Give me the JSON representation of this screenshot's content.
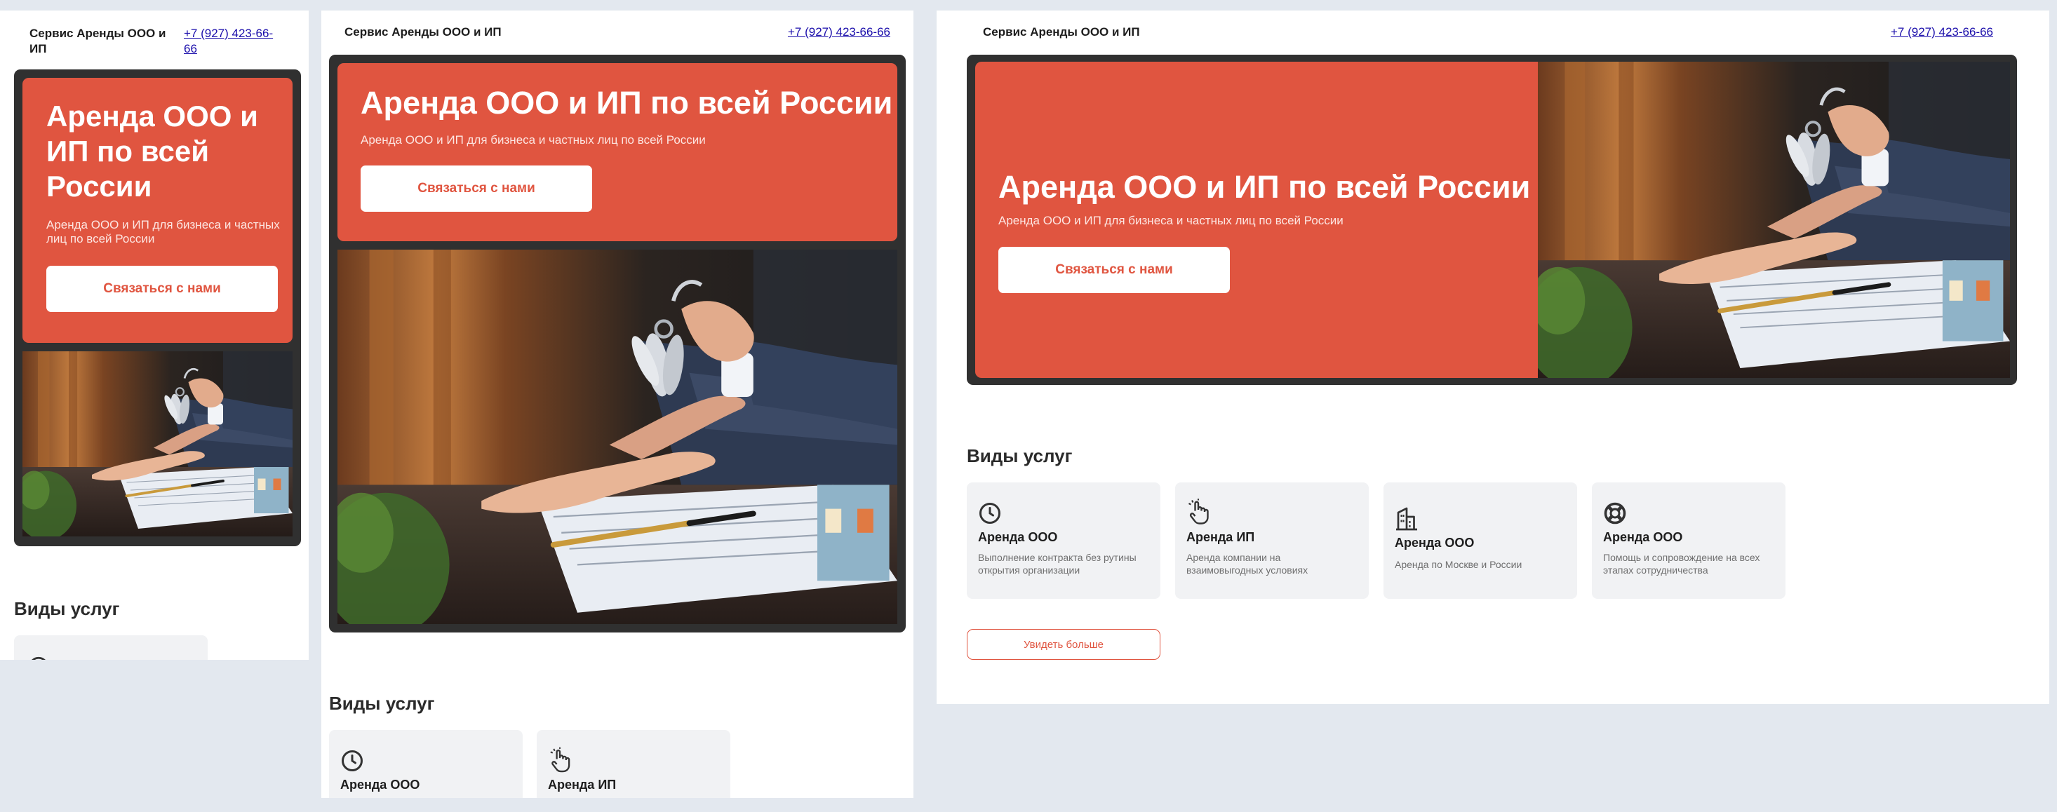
{
  "brand": "Сервис Аренды ООО и ИП",
  "phone": "+7 (927) 423-66-66",
  "hero": {
    "title": "Аренда ООО и ИП по всей России",
    "subtitle": "Аренда ООО и ИП для бизнеса и частных лиц по всей России",
    "cta_label": "Связаться с нами"
  },
  "services": {
    "title": "Виды услуг",
    "cards": [
      {
        "icon": "clock-icon",
        "title": "Аренда ООО",
        "desc": "Выполнение контракта без рутины открытия организации"
      },
      {
        "icon": "hand-pointer-icon",
        "title": "Аренда ИП",
        "desc": "Аренда компании на взаимовыгодных условиях"
      },
      {
        "icon": "buildings-icon",
        "title": "Аренда ООО",
        "desc": "Аренда по Москве и России"
      },
      {
        "icon": "lifebuoy-icon",
        "title": "Аренда ООО",
        "desc": "Помощь и сопровождение на всех этапах сотрудничества"
      }
    ],
    "more_label": "Увидеть больше"
  },
  "colors": {
    "accent": "#e05540",
    "dark": "#303030",
    "card_bg": "#f1f2f4",
    "page_bg": "#e3e8ef"
  }
}
